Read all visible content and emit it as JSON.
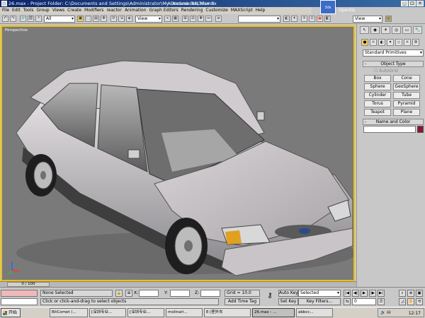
{
  "window": {
    "title": "26.max   - Project Folder: C:\\Documents and Settings\\Administrator\\My Documents\\3dsmax",
    "app_title": "- Autodesk 3ds Max 9",
    "renderer": "OpenGL",
    "controls": [
      "_",
      "□",
      "×"
    ]
  },
  "menu": [
    "File",
    "Edit",
    "Tools",
    "Group",
    "Views",
    "Create",
    "Modifiers",
    "reactor",
    "Animation",
    "Graph Editors",
    "Rendering",
    "Customize",
    "MAXScript",
    "Help"
  ],
  "toolbar": {
    "selection_filter": "All",
    "ref_coord": "View",
    "named_selection": "",
    "right_view_dd": "View",
    "tool_glyphs": [
      "↶",
      "↷",
      "🔗",
      "⛓",
      "⚡",
      "▣",
      "⬚",
      "▤",
      "✥",
      "⟳",
      "⇲",
      "◈",
      "⌖",
      "▦",
      "⊞",
      "⊟",
      "✚",
      "↔",
      "≡",
      "◐",
      "✦",
      "☀",
      "⊙",
      "🫖",
      "◧"
    ]
  },
  "viewport": {
    "label": "Perspective",
    "accent": "#f0c000",
    "background": "#7a7a7a"
  },
  "command_panel": {
    "tab_glyphs": [
      "↖",
      "◉",
      "✈",
      "◎",
      "▭",
      "🔧"
    ],
    "create_icons": [
      "●",
      "☼",
      "◐",
      "✦",
      "◇",
      "⚛",
      "⚙"
    ],
    "category": "Standard Primitives",
    "object_type_title": "Object Type",
    "autogrid": "AutoGrid",
    "primitives": [
      "Box",
      "Cone",
      "Sphere",
      "GeoSphere",
      "Cylinder",
      "Tube",
      "Torus",
      "Pyramid",
      "Teapot",
      "Plane"
    ],
    "name_color_title": "Name and Color",
    "color_swatch": "#8c1432",
    "rollout_sign": "-"
  },
  "timeline": {
    "frame": "0 / 100"
  },
  "status": {
    "selection": "None Selected",
    "prompt": "Click or click-and-drag to select objects",
    "x_label": "X:",
    "y_label": "Y:",
    "z_label": "Z:",
    "grid": "Grid = 10.0",
    "add_time_tag": "Add Time Tag",
    "auto_key": "Auto Key",
    "set_key": "Set Key",
    "key_mode": "Selected",
    "key_filters": "Key Filters...",
    "current_frame": "0",
    "playback": [
      "|◀",
      "◀|",
      "▶",
      "|▶",
      "▶|"
    ]
  },
  "taskbar": {
    "start": "开始",
    "tasks": [
      "BitComet (...",
      "[深圳专业...",
      "[深圳专业...",
      "molinari...",
      "E:\\室外车",
      "26.max - ...",
      "abbcc..."
    ],
    "clock": "12:17"
  }
}
